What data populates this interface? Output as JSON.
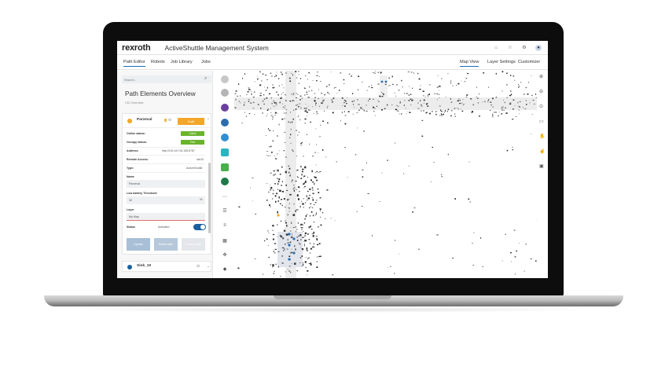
{
  "app": {
    "logo": "rexroth",
    "title": "ActiveShuttle Management System"
  },
  "header_icons": [
    "home-icon",
    "star-icon",
    "gear-icon",
    "user-icon"
  ],
  "nav": {
    "left_tabs": [
      "Path Editor",
      "Robots",
      "Job Library",
      "Jobs"
    ],
    "active_tab": "Path Editor",
    "right_tabs": [
      "Map View",
      "Layer Settings",
      "Customizer"
    ],
    "active_right_tab": "Map View"
  },
  "panel": {
    "search_placeholder": "Search...",
    "title": "Path Elements Overview",
    "subtitle": "CDI Overview",
    "card": {
      "name": "Parzeval",
      "badge": "Draft",
      "online_label": "Online status:",
      "online_value": "Online",
      "occupy_label": "Occupy status:",
      "occupy_value": "Free",
      "address_label": "Address:",
      "address_value": "http://100.167.06.155:6787",
      "remote_label": "Remote Access:",
      "remote_value": "ssh22",
      "type_label": "Type:",
      "type_value": "ActiveShuttle",
      "name_label": "Name",
      "name_value": "Parzeval",
      "battery_label": "Low battery Threshold",
      "battery_value": "30",
      "battery_unit": "%",
      "layer_label": "Layer",
      "layer_value": "My Map",
      "status_label": "Status",
      "status_value": "Activated",
      "status_on": true,
      "buttons": [
        "Update",
        "Reset state",
        "Create state"
      ]
    },
    "card2_name": "Sink_10"
  },
  "colors": {
    "accent": "#1b5f9e",
    "draft": "#f4a62a",
    "ok": "#6ab42d"
  }
}
